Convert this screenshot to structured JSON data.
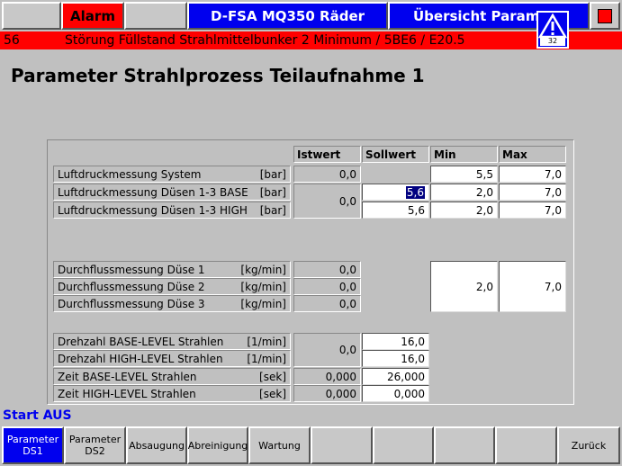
{
  "header": {
    "alarm_label": "Alarm",
    "machine_title": "D-FSA MQ350 Räder",
    "screen_title": "Übersicht Parame"
  },
  "alarm_bar": {
    "number": "56",
    "message": "Störung Füllstand Strahlmittelbunker 2 Minimum / 5BE6 / E20.5"
  },
  "warning": {
    "count": "32"
  },
  "page_title": "Parameter Strahlprozess Teilaufnahme 1",
  "columns": {
    "ist": "Istwert",
    "soll": "Sollwert",
    "min": "Min",
    "max": "Max"
  },
  "rows": {
    "r1": {
      "label": "Luftdruckmessung System",
      "unit": "[bar]",
      "ist": "0,0",
      "min": "5,5",
      "max": "7,0"
    },
    "r2": {
      "label": "Luftdruckmessung Düsen 1-3 BASE",
      "unit": "[bar]",
      "soll": "5,6",
      "min": "2,0",
      "max": "7,0"
    },
    "r3": {
      "label": "Luftdruckmessung Düsen 1-3 HIGH",
      "unit": "[bar]",
      "soll": "5,6",
      "min": "2,0",
      "max": "7,0"
    },
    "r23_ist": "0,0",
    "r4": {
      "label": "Durchflussmessung Düse 1",
      "unit": "[kg/min]",
      "ist": "0,0"
    },
    "r5": {
      "label": "Durchflussmessung Düse 2",
      "unit": "[kg/min]",
      "ist": "0,0"
    },
    "r6": {
      "label": "Durchflussmessung Düse 3",
      "unit": "[kg/min]",
      "ist": "0,0"
    },
    "r456_min": "2,0",
    "r456_max": "7,0",
    "r7": {
      "label": "Drehzahl BASE-LEVEL Strahlen",
      "unit": "[1/min]",
      "soll": "16,0"
    },
    "r8": {
      "label": "Drehzahl HIGH-LEVEL Strahlen",
      "unit": "[1/min]",
      "soll": "16,0"
    },
    "r78_ist": "0,0",
    "r9": {
      "label": "Zeit BASE-LEVEL Strahlen",
      "unit": "[sek]",
      "ist": "0,000",
      "soll": "26,000"
    },
    "r10": {
      "label": "Zeit HIGH-LEVEL Strahlen",
      "unit": "[sek]",
      "ist": "0,000",
      "soll": "0,000"
    }
  },
  "status": "Start AUS",
  "buttons": {
    "b1": "Parameter DS1",
    "b2": "Parameter DS2",
    "b3": "Absaugung",
    "b4": "Abreinigung",
    "b5": "Wartung",
    "b10": "Zurück"
  },
  "colors": {
    "accent_blue": "#0000ee",
    "alarm_red": "#ff0000",
    "panel_grey": "#c0c0c0"
  }
}
